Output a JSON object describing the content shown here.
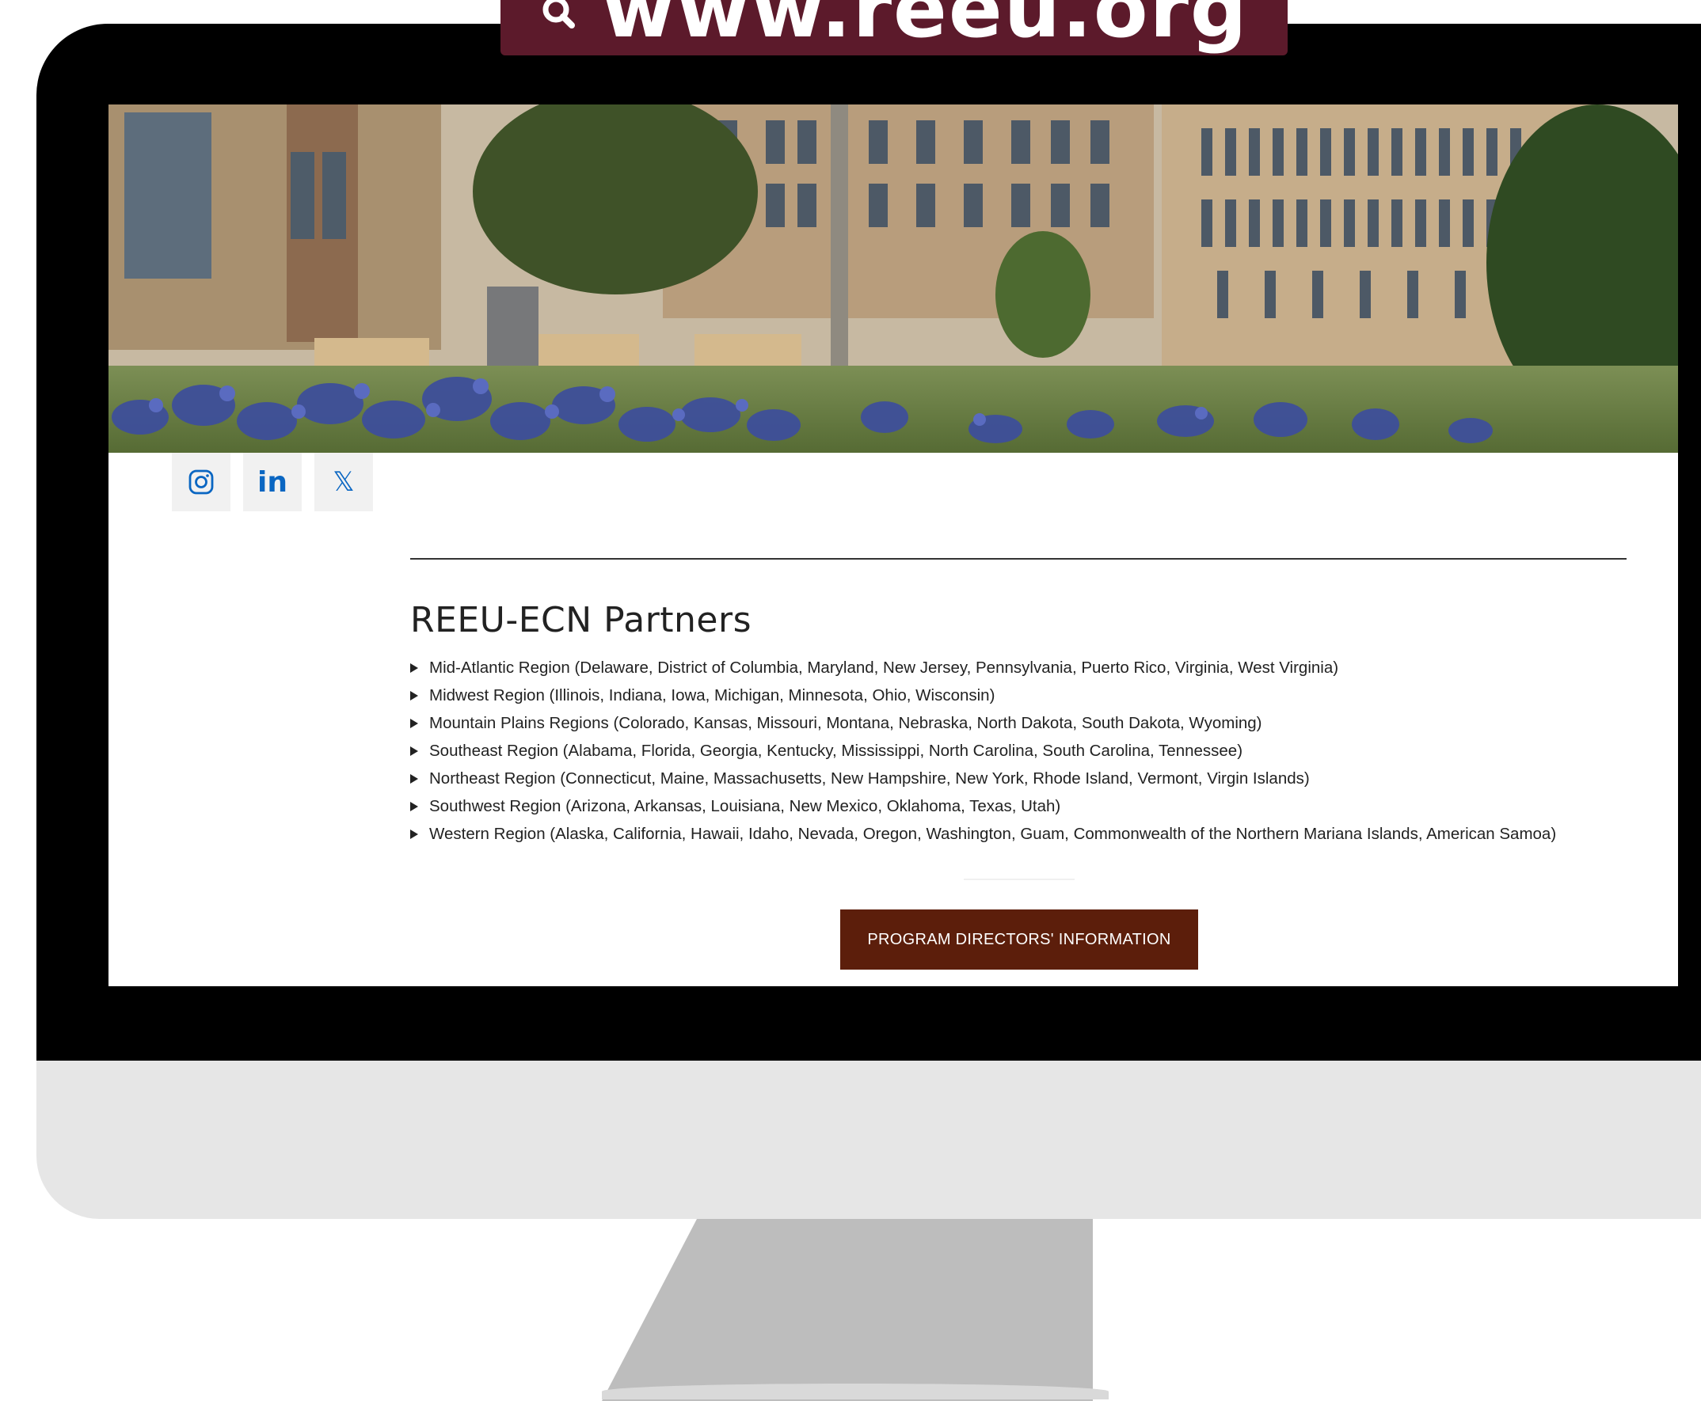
{
  "banner": {
    "url": "www.reeu.org",
    "search_icon": "search-icon"
  },
  "social": [
    {
      "name": "instagram",
      "icon": "instagram-icon"
    },
    {
      "name": "linkedin",
      "icon": "linkedin-icon",
      "glyph": "in"
    },
    {
      "name": "x",
      "icon": "x-icon",
      "glyph": "𝕏"
    }
  ],
  "partners": {
    "title": "REEU-ECN Partners",
    "regions": [
      "Mid-Atlantic Region (Delaware, District of Columbia, Maryland, New Jersey, Pennsylvania, Puerto Rico, Virginia, West Virginia)",
      "Midwest Region (Illinois, Indiana, Iowa, Michigan, Minnesota, Ohio, Wisconsin)",
      "Mountain Plains Regions (Colorado, Kansas, Missouri, Montana, Nebraska, North Dakota, South Dakota, Wyoming)",
      "Southeast Region (Alabama, Florida, Georgia, Kentucky, Mississippi, North Carolina, South Carolina, Tennessee)",
      "Northeast Region (Connecticut, Maine, Massachusetts, New Hampshire, New York, Rhode Island, Vermont, Virgin Islands)",
      "Southwest Region (Arizona, Arkansas, Louisiana, New Mexico, Oklahoma, Texas, Utah)",
      "Western Region (Alaska, California, Hawaii, Idaho, Nevada, Oregon, Washington, Guam, Commonwealth of the Northern Mariana Islands, American Samoa)"
    ]
  },
  "cta": {
    "label": "PROGRAM DIRECTORS' INFORMATION"
  },
  "colors": {
    "banner": "#5c1a2b",
    "button": "#5c1e0b",
    "linkedin": "#0a66c2",
    "bezel": "#000000",
    "monitor_body": "#e6e6e6",
    "stand": "#bdbdbd"
  }
}
